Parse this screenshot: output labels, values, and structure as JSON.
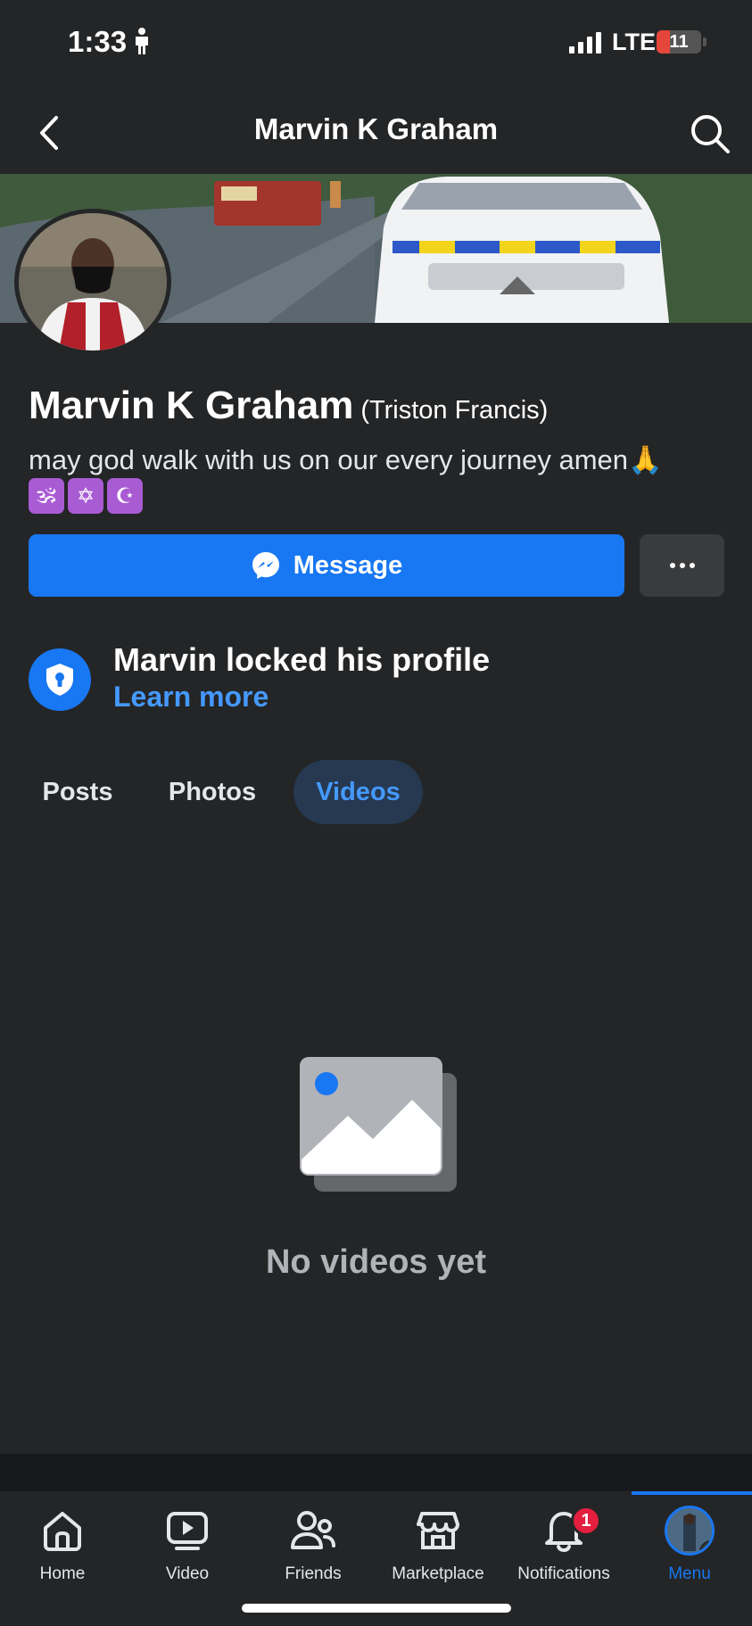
{
  "status_bar": {
    "time": "1:33",
    "network": "LTE",
    "battery": "11",
    "battery_level_percent": 11
  },
  "header": {
    "title": "Marvin K Graham",
    "back_icon": "chevron-left-icon",
    "search_icon": "search-icon"
  },
  "profile": {
    "name": "Marvin K Graham",
    "alternate_name": "(Triston Francis)",
    "bio": "may god walk with us on our every journey amen🙏",
    "bio_emojis": [
      "🕉",
      "✡",
      "☪"
    ]
  },
  "actions": {
    "message_label": "Message",
    "message_icon": "messenger-icon",
    "more_icon": "more-icon"
  },
  "lock_notice": {
    "title": "Marvin locked his profile",
    "link": "Learn more",
    "icon": "shield-lock-icon"
  },
  "tabs": [
    {
      "label": "Posts",
      "active": false
    },
    {
      "label": "Photos",
      "active": false
    },
    {
      "label": "Videos",
      "active": true
    }
  ],
  "empty_state": {
    "text": "No videos yet",
    "icon": "image-placeholder-icon"
  },
  "bottom_nav": [
    {
      "label": "Home",
      "icon": "home-icon"
    },
    {
      "label": "Video",
      "icon": "video-icon"
    },
    {
      "label": "Friends",
      "icon": "friends-icon"
    },
    {
      "label": "Marketplace",
      "icon": "marketplace-icon"
    },
    {
      "label": "Notifications",
      "icon": "bell-icon",
      "badge": "1"
    },
    {
      "label": "Menu",
      "icon": "menu-avatar-icon",
      "active": true
    }
  ],
  "colors": {
    "background": "#242526",
    "accent": "#1877f2",
    "link": "#4599ff",
    "badge": "#e41e3f"
  }
}
